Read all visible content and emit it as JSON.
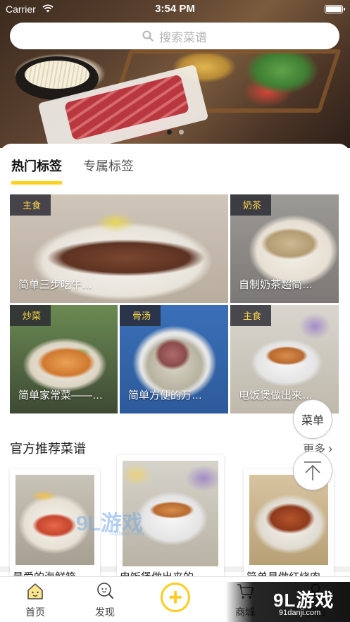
{
  "status_bar": {
    "carrier": "Carrier",
    "time": "3:54 PM"
  },
  "search": {
    "placeholder": "搜索菜谱"
  },
  "banner": {
    "page_count": 2,
    "active_page": 1
  },
  "tabs": [
    {
      "label": "热门标签",
      "active": true
    },
    {
      "label": "专属标签",
      "active": false
    }
  ],
  "tag_tiles": [
    {
      "tag": "主食",
      "caption": "简单三步吃牛…"
    },
    {
      "tag": "奶茶",
      "caption": "自制奶茶超简…"
    },
    {
      "tag": "炒菜",
      "caption": "简单家常菜——…"
    },
    {
      "tag": "骨汤",
      "caption": "简单方便的万…"
    },
    {
      "tag": "主食",
      "caption": "电饭煲做出来…"
    }
  ],
  "floating": {
    "menu_label": "菜单"
  },
  "recommended": {
    "title": "官方推荐菜谱",
    "more_label": "更多",
    "items": [
      {
        "title": "最爱的海鲜箱…"
      },
      {
        "title": "电饭煲做出来的…"
      },
      {
        "title": "简单易做红烧肉…"
      }
    ]
  },
  "tabbar": {
    "items": [
      {
        "label": "首页",
        "icon": "home-icon",
        "active": true
      },
      {
        "label": "发现",
        "icon": "discover-icon"
      },
      {
        "label": "",
        "icon": "add-icon"
      },
      {
        "label": "商城",
        "icon": "cart-icon"
      },
      {
        "label": "我的",
        "icon": "profile-icon"
      }
    ]
  },
  "watermark": {
    "logo": "9L游戏",
    "url": "91danji.com"
  },
  "colors": {
    "accent": "#ffd21f",
    "tag_bg": "#2a2a32",
    "tag_text": "#ffd64a"
  }
}
